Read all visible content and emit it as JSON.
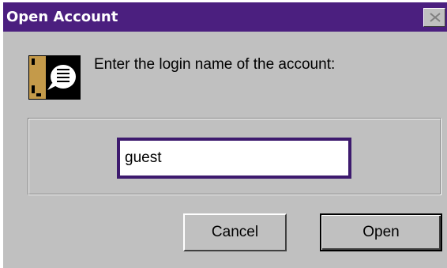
{
  "dialog": {
    "title": "Open Account",
    "prompt": "Enter the login name of the account:",
    "icon": "message-speaker-icon",
    "close_icon": "close-icon"
  },
  "form": {
    "login_value": "guest"
  },
  "buttons": {
    "cancel_label": "Cancel",
    "open_label": "Open"
  },
  "colors": {
    "titlebar": "#4b1f7f",
    "dialog_bg": "#c0c0c0",
    "input_border": "#3d1a6e"
  }
}
